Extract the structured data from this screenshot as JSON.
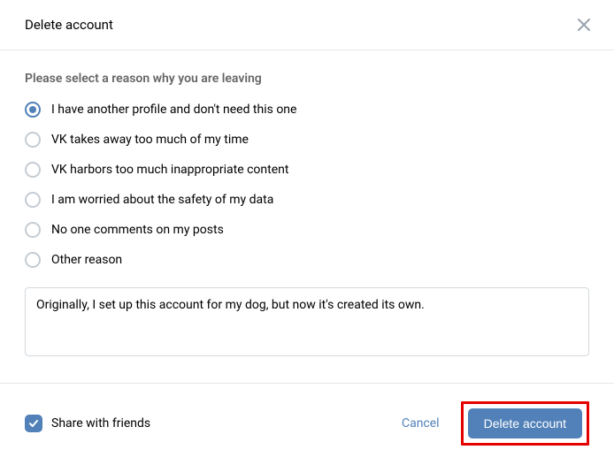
{
  "header": {
    "title": "Delete account"
  },
  "body": {
    "prompt": "Please select a reason why you are leaving",
    "reasons": [
      "I have another profile and don't need this one",
      "VK takes away too much of my time",
      "VK harbors too much inappropriate content",
      "I am worried about the safety of my data",
      "No one comments on my posts",
      "Other reason"
    ],
    "selected_reason_index": 0,
    "textarea_value": "Originally, I set up this account for my dog, but now it's created its own."
  },
  "footer": {
    "share_label": "Share with friends",
    "share_checked": true,
    "cancel_label": "Cancel",
    "delete_label": "Delete account"
  }
}
